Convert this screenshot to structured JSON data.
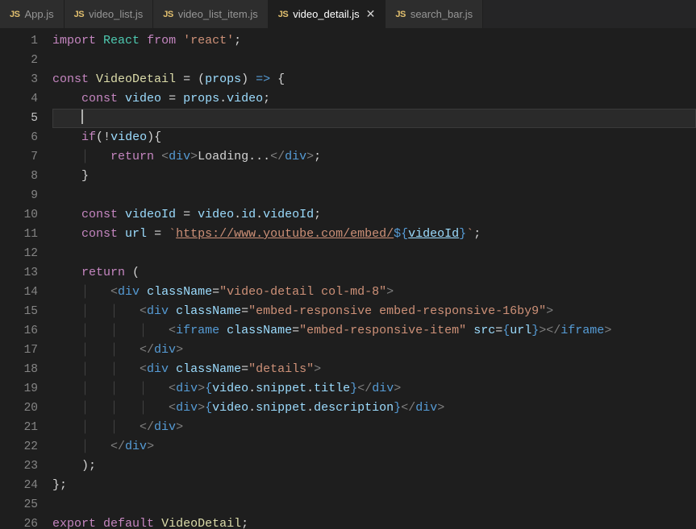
{
  "tabs": [
    {
      "icon": "JS",
      "label": "App.js",
      "active": false
    },
    {
      "icon": "JS",
      "label": "video_list.js",
      "active": false
    },
    {
      "icon": "JS",
      "label": "video_list_item.js",
      "active": false
    },
    {
      "icon": "JS",
      "label": "video_detail.js",
      "active": true,
      "close": "✕"
    },
    {
      "icon": "JS",
      "label": "search_bar.js",
      "active": false
    }
  ],
  "editor": {
    "current_line": 5,
    "line_numbers": [
      "1",
      "2",
      "3",
      "4",
      "5",
      "6",
      "7",
      "8",
      "9",
      "10",
      "11",
      "12",
      "13",
      "14",
      "15",
      "16",
      "17",
      "18",
      "19",
      "20",
      "21",
      "22",
      "23",
      "24",
      "25",
      "26"
    ],
    "code": {
      "l1": {
        "import": "import",
        "React": "React",
        "from": "from",
        "react_str": "'react'",
        "semi": ";"
      },
      "l3": {
        "const": "const",
        "VideoDetail": "VideoDetail",
        "eq": " = ",
        "lp": "(",
        "props": "props",
        "rp": ")",
        "arrow": " => ",
        "lb": "{"
      },
      "l4": {
        "const": "const",
        "video": "video",
        "eq": " = ",
        "props": "props",
        "dot": ".",
        "video2": "video",
        "semi": ";"
      },
      "l6": {
        "if": "if",
        "lp": "(",
        "bang": "!",
        "video": "video",
        "rp": ")",
        "lb": "{"
      },
      "l7": {
        "return": "return",
        "obr": "<",
        "div": "div",
        "cbr": ">",
        "text": "Loading...",
        "obr2": "</",
        "div2": "div",
        "cbr2": ">",
        "semi": ";"
      },
      "l8": {
        "rb": "}"
      },
      "l10": {
        "const": "const",
        "videoId": "videoId",
        "eq": " = ",
        "video": "video",
        "d1": ".",
        "id": "id",
        "d2": ".",
        "videoId2": "videoId",
        "semi": ";"
      },
      "l11": {
        "const": "const",
        "url": "url",
        "eq": " = ",
        "bt": "`",
        "url_text": "https://www.youtube.com/embed/",
        "d_open": "${",
        "videoId": "videoId",
        "d_close": "}",
        "bt2": "`",
        "semi": ";"
      },
      "l13": {
        "return": "return",
        "lp": " ("
      },
      "l14": {
        "o": "<",
        "div": "div",
        "attr": "className",
        "eq": "=",
        "val": "\"video-detail col-md-8\"",
        "c": ">"
      },
      "l15": {
        "o": "<",
        "div": "div",
        "attr": "className",
        "eq": "=",
        "val": "\"embed-responsive embed-responsive-16by9\"",
        "c": ">"
      },
      "l16": {
        "o": "<",
        "tag": "iframe",
        "attr": "className",
        "eq": "=",
        "val": "\"embed-responsive-item\"",
        "attr2": "src",
        "eq2": "=",
        "lb": "{",
        "url": "url",
        "rb": "}",
        "c": ">",
        "o2": "</",
        "tag2": "iframe",
        "c2": ">"
      },
      "l17": {
        "o": "</",
        "div": "div",
        "c": ">"
      },
      "l18": {
        "o": "<",
        "div": "div",
        "attr": "className",
        "eq": "=",
        "val": "\"details\"",
        "c": ">"
      },
      "l19": {
        "o": "<",
        "div": "div",
        "c": ">",
        "lb": "{",
        "expr_a": "video",
        "d1": ".",
        "expr_b": "snippet",
        "d2": ".",
        "expr_c": "title",
        "rb": "}",
        "o2": "</",
        "div2": "div",
        "c2": ">"
      },
      "l20": {
        "o": "<",
        "div": "div",
        "c": ">",
        "lb": "{",
        "expr_a": "video",
        "d1": ".",
        "expr_b": "snippet",
        "d2": ".",
        "expr_c": "description",
        "rb": "}",
        "o2": "</",
        "div2": "div",
        "c2": ">"
      },
      "l21": {
        "o": "</",
        "div": "div",
        "c": ">"
      },
      "l22": {
        "o": "</",
        "div": "div",
        "c": ">"
      },
      "l23": {
        "rp": ")",
        "semi": ";"
      },
      "l24": {
        "rb": "}",
        "semi": ";"
      },
      "l26": {
        "export": "export",
        "default": "default",
        "VideoDetail": "VideoDetail",
        "semi": ";"
      }
    }
  }
}
